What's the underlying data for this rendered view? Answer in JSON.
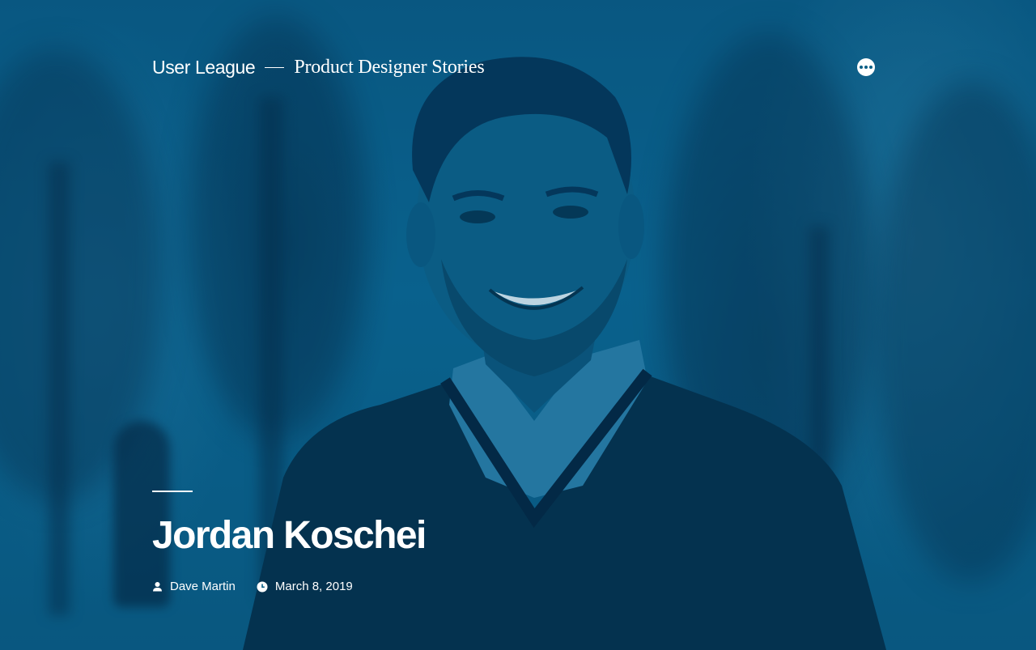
{
  "header": {
    "site_title": "User League",
    "site_description": "Product Designer Stories",
    "menu_icon": "ellipsis-icon"
  },
  "post": {
    "title": "Jordan Koschei",
    "author": "Dave Martin",
    "date": "March 8, 2019",
    "author_icon": "person-icon",
    "date_icon": "clock-icon"
  },
  "colors": {
    "overlay": "#0a5f86",
    "text": "#ffffff"
  }
}
